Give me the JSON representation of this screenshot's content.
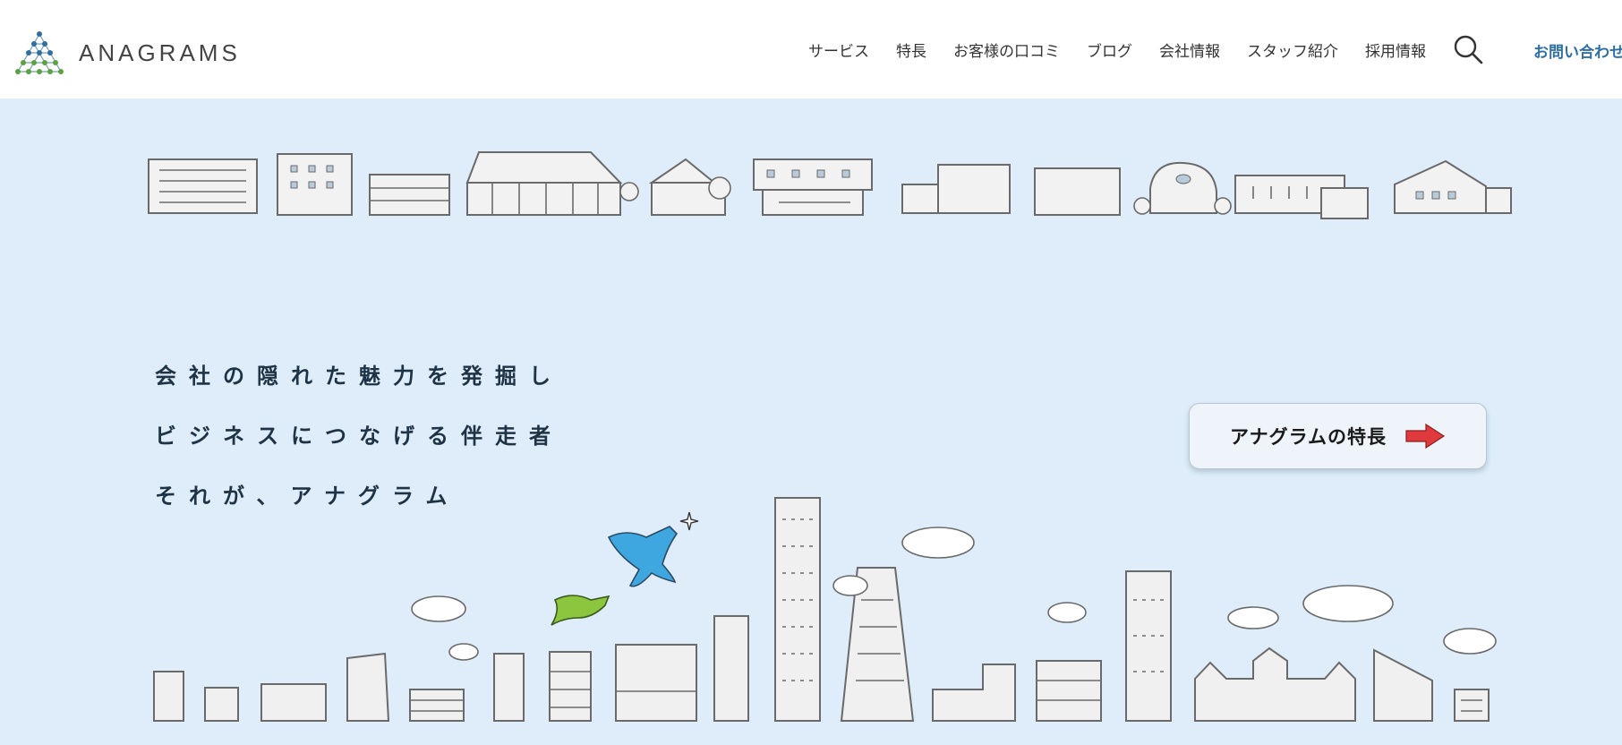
{
  "brand": {
    "name": "ANAGRAMS",
    "logo_icon": "triangle-dots-icon"
  },
  "nav": {
    "items": [
      "サービス",
      "特長",
      "お客様の口コミ",
      "ブログ",
      "会社情報",
      "スタッフ紹介",
      "採用情報"
    ],
    "search_icon": "search-icon",
    "contact_label": "お問い合わせ"
  },
  "hero": {
    "tagline": [
      "会社の隠れた魅力を発掘し",
      "ビジネスにつなげる伴走者",
      "それが、アナグラム"
    ],
    "cta_label": "アナグラムの特長",
    "cta_icon": "red-arrow-icon"
  },
  "colors": {
    "accent_blue": "#2e6fa7",
    "background": "#deedf9",
    "arrow_red": "#e03a3e",
    "bird_blue": "#3fa7e0",
    "bird_green": "#8cc63f"
  }
}
